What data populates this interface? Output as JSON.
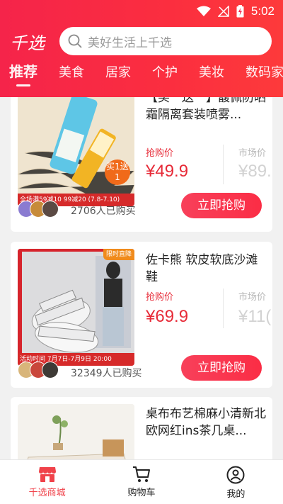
{
  "status_bar": {
    "time": "5:02"
  },
  "header": {
    "logo": "千选",
    "search_placeholder": "美好生活上千选"
  },
  "tabs": [
    {
      "label": "推荐"
    },
    {
      "label": "美食"
    },
    {
      "label": "居家"
    },
    {
      "label": "个护"
    },
    {
      "label": "美妆"
    },
    {
      "label": "数码家"
    }
  ],
  "products": [
    {
      "title": "【买一送一】馥佩防晒霜隔离套装喷雾...",
      "price_label": "抢购价",
      "price": "¥49.9",
      "market_label": "市场价",
      "market_price": "¥89.",
      "buyers": "2706人已购买",
      "button": "立即抢购",
      "badge": "买1送1",
      "promo_strip": "全场满59减10 99减20 (7.8-7.10)"
    },
    {
      "title": "佐卡熊 软皮软底沙滩鞋",
      "price_label": "抢购价",
      "price": "¥69.9",
      "market_label": "市场价",
      "market_price": "¥11(",
      "buyers": "32349人已购买",
      "button": "立即抢购",
      "flash_tag": "限时直降",
      "promo_strip": "活动时间  7月7日-7月9日 20:00"
    },
    {
      "title": "桌布布艺棉麻小清新北欧网红ins茶几桌..."
    }
  ],
  "bottom_nav": [
    {
      "label": "千选商城"
    },
    {
      "label": "购物车"
    },
    {
      "label": "我的"
    }
  ],
  "colors": {
    "brand_red": "#fb2e3f",
    "price_red": "#e72b38",
    "nav_active": "#f0424a"
  }
}
